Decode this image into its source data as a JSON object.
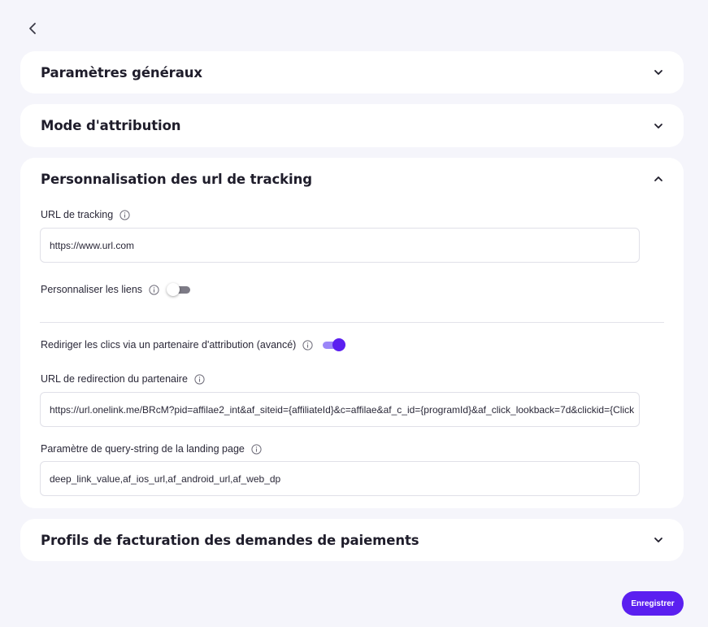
{
  "sections": [
    {
      "title": "Paramètres généraux",
      "expanded": false
    },
    {
      "title": "Mode d'attribution",
      "expanded": false
    },
    {
      "title": "Personnalisation des url de tracking",
      "expanded": true
    },
    {
      "title": "Profils de facturation des demandes de paiements",
      "expanded": false
    }
  ],
  "tracking": {
    "url_label": "URL de tracking",
    "url_value": "https://www.url.com",
    "customize_links_label": "Personnaliser les liens",
    "customize_links_on": false,
    "redirect_label": "Rediriger les clics via un partenaire d'attribution (avancé)",
    "redirect_on": true,
    "partner_url_label": "URL de redirection du partenaire",
    "partner_url_value": "https://url.onelink.me/BRcM?pid=affilae2_int&af_siteid={affiliateId}&c=affilae&af_c_id={programId}&af_click_lookback=7d&clickid={Click",
    "query_param_label": "Paramètre de query-string de la landing page",
    "query_param_value": "deep_link_value,af_ios_url,af_android_url,af_web_dp"
  },
  "actions": {
    "save_label": "Enregistrer"
  },
  "colors": {
    "accent": "#5b1ff0",
    "accent_light": "#9b86f8",
    "background": "#f5f5fb"
  },
  "icons": {
    "back": "chevron-left-icon",
    "collapse": "chevron-down-icon",
    "expand": "chevron-up-icon",
    "info": "info-icon"
  }
}
